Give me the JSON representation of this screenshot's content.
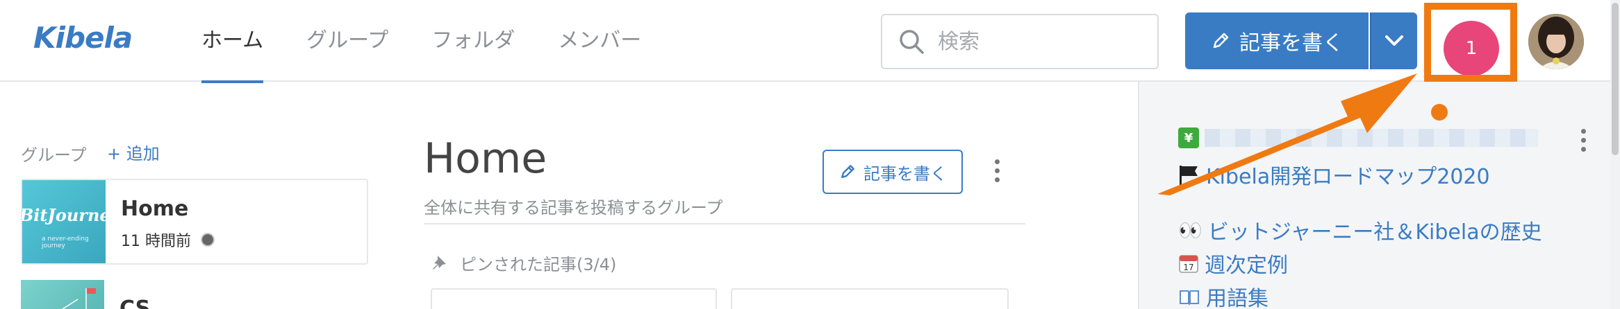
{
  "header": {
    "logo": "Kibela",
    "nav": [
      "ホーム",
      "グループ",
      "フォルダ",
      "メンバー"
    ],
    "search_placeholder": "検索",
    "write_label": "記事を書く",
    "notification_count": "1"
  },
  "sidebar": {
    "groups_label": "グループ",
    "add_label": "+ 追加",
    "group1": {
      "name": "Home",
      "thumb_text": "BitJourney",
      "thumb_sub": "a never-ending journey",
      "time": "11 時間前"
    },
    "group2": {
      "name": "CS"
    }
  },
  "main": {
    "title": "Home",
    "description": "全体に共有する記事を投稿するグループ",
    "write_label": "記事を書く",
    "pinned_label": "ピンされた記事(3/4)"
  },
  "right_panel": {
    "line2": "Kibela開発ロードマップ2020",
    "line3": "ビットジャーニー社＆Kibelaの歴史",
    "line4": "週次定例",
    "line5": "用語集",
    "icons": [
      "yen-chart-icon",
      "flag-icon",
      "eyes-icon",
      "calendar-icon",
      "book-icon"
    ]
  },
  "colors": {
    "brand": "#3a7cc4",
    "badge": "#e8457a",
    "annotation": "#f07a12"
  }
}
